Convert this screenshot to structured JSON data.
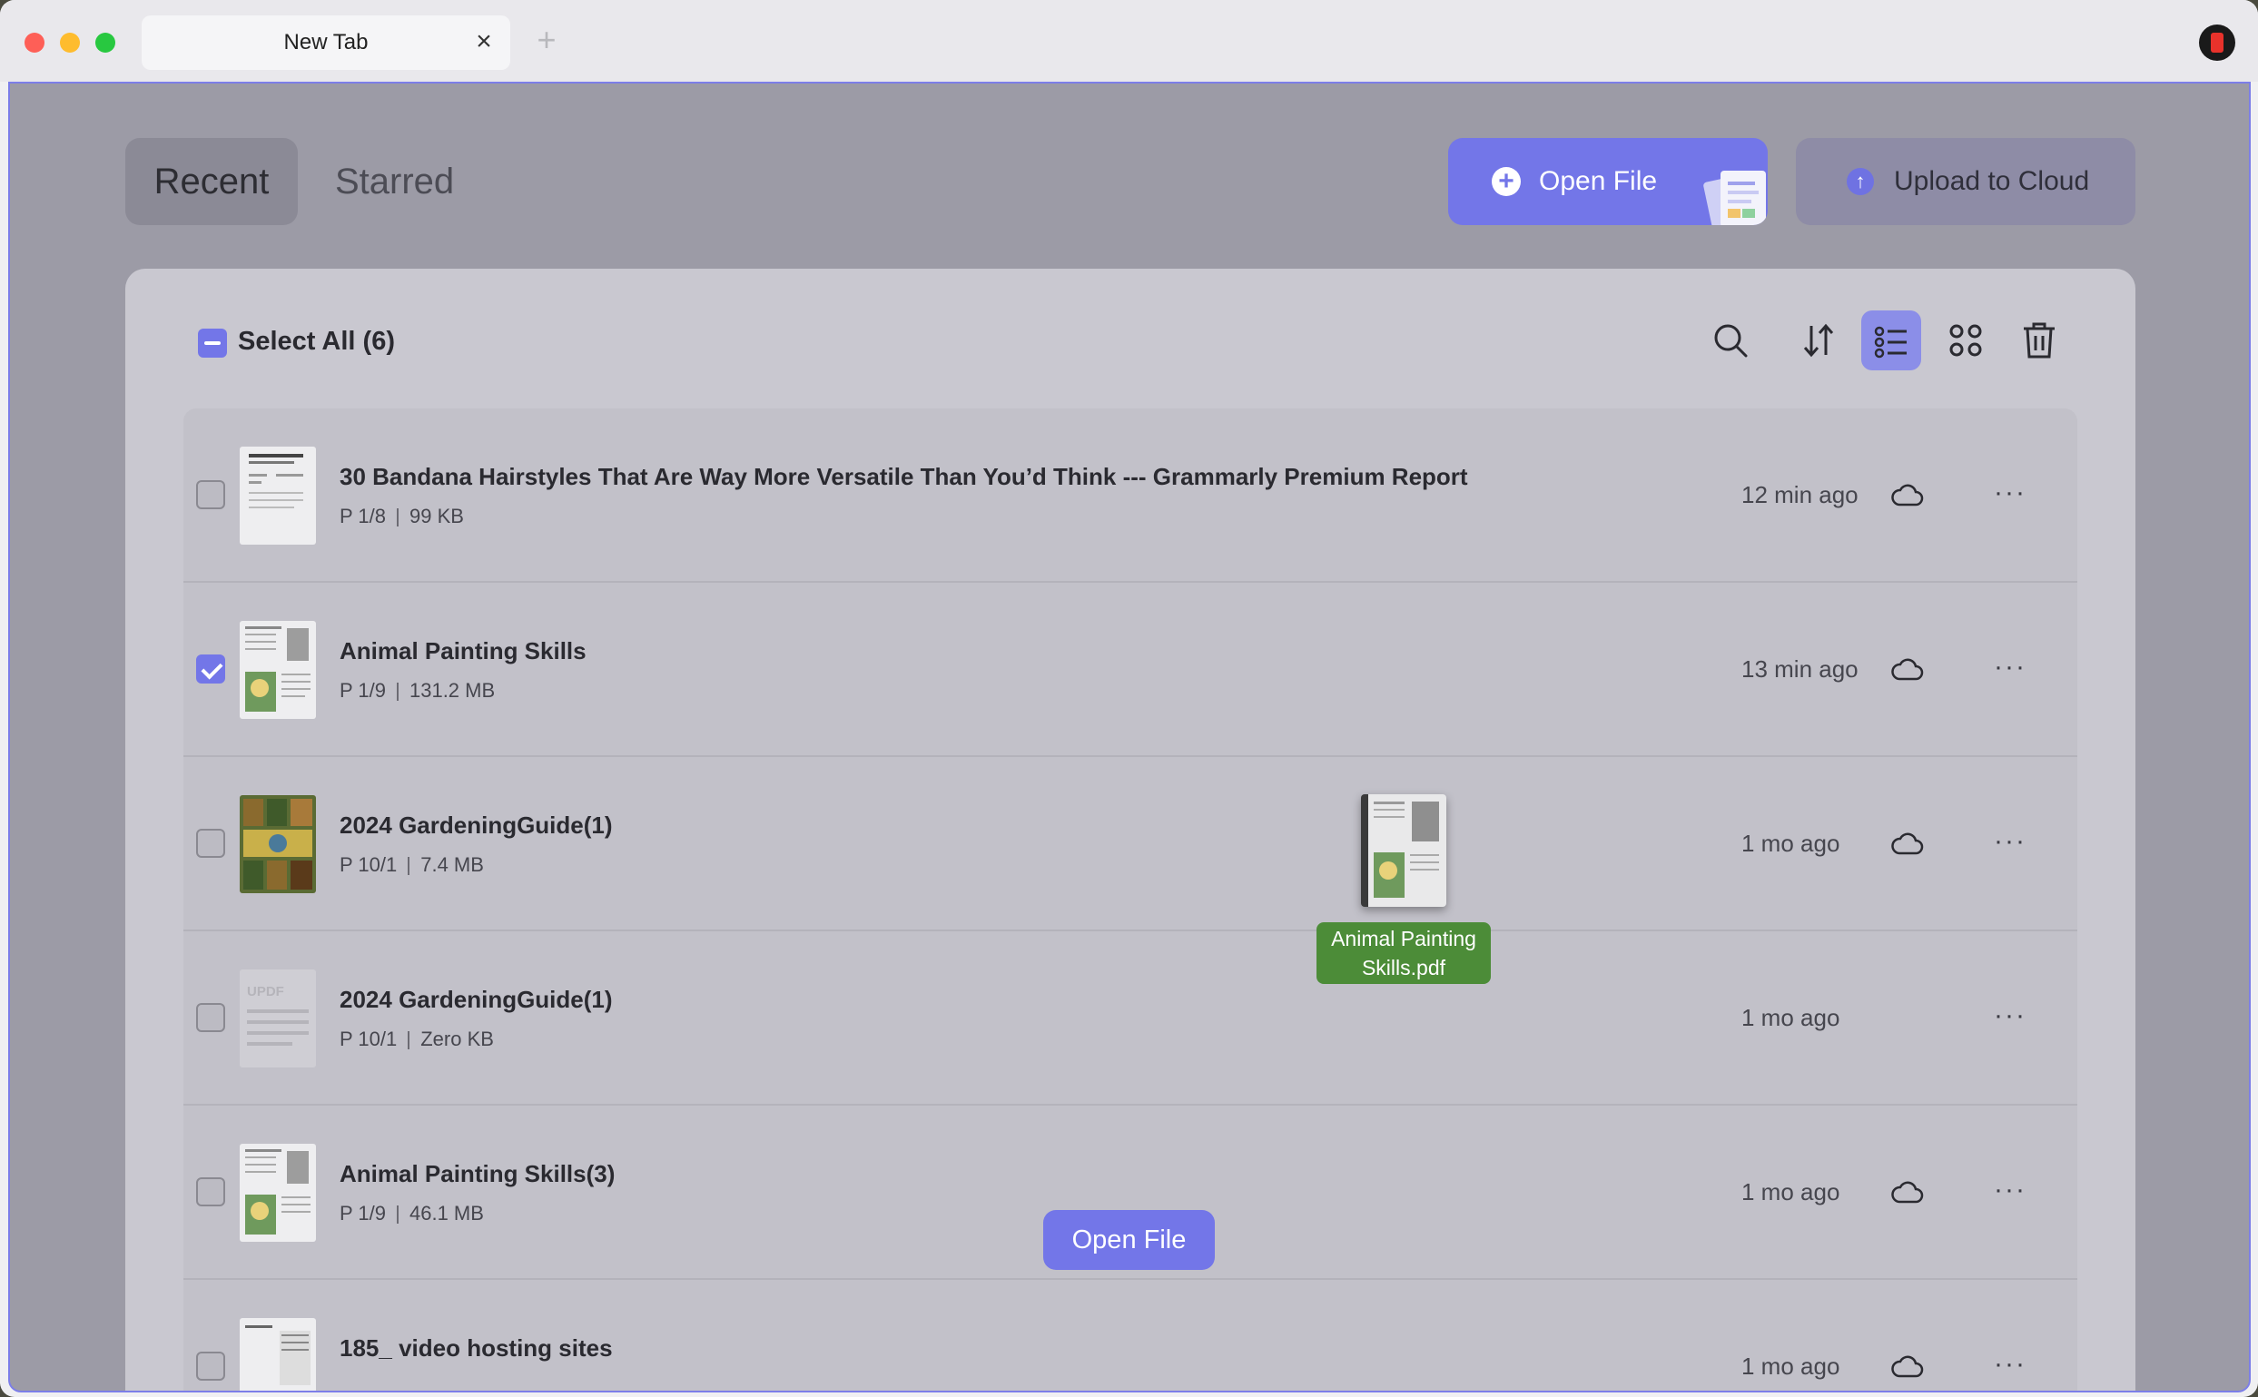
{
  "window": {
    "tab_title": "New Tab",
    "tab_close": "×",
    "new_tab": "+"
  },
  "header": {
    "segments": [
      {
        "label": "Recent",
        "selected": true
      },
      {
        "label": "Starred",
        "selected": false
      }
    ],
    "open_file_label": "Open File",
    "upload_label": "Upload to Cloud"
  },
  "toolbar": {
    "select_all_label": "Select All (6)",
    "tools": [
      "search-icon",
      "sort-icon",
      "list-view-icon",
      "grid-view-icon",
      "trash-icon"
    ],
    "active_view": "list"
  },
  "files": [
    {
      "name": "30 Bandana Hairstyles That Are Way More Versatile Than You’d Think --- Grammarly Premium Report",
      "pages": "P 1/8",
      "size": "99 KB",
      "time": "12 min ago",
      "checked": false,
      "cloud": true
    },
    {
      "name": "Animal Painting Skills",
      "pages": "P 1/9",
      "size": "131.2 MB",
      "time": "13 min ago",
      "checked": true,
      "cloud": true
    },
    {
      "name": "2024 GardeningGuide(1)",
      "pages": "P 10/1",
      "size": "7.4 MB",
      "time": "1 mo ago",
      "checked": false,
      "cloud": true
    },
    {
      "name": "2024 GardeningGuide(1)",
      "pages": "P 10/1",
      "size": "Zero KB",
      "time": "1 mo ago",
      "checked": false,
      "cloud": false
    },
    {
      "name": "Animal Painting Skills(3)",
      "pages": "P 1/9",
      "size": "46.1 MB",
      "time": "1 mo ago",
      "checked": false,
      "cloud": true
    },
    {
      "name": "185_ video hosting sites",
      "pages": "",
      "size": "",
      "time": "1 mo ago",
      "checked": false,
      "cloud": true
    }
  ],
  "drag": {
    "filename": "Animal Painting Skills.pdf"
  },
  "floating_button": "Open File",
  "thumbnail_watermark": "UPDF",
  "colors": {
    "accent": "#7376e8",
    "drag_label": "#4c8c38"
  }
}
